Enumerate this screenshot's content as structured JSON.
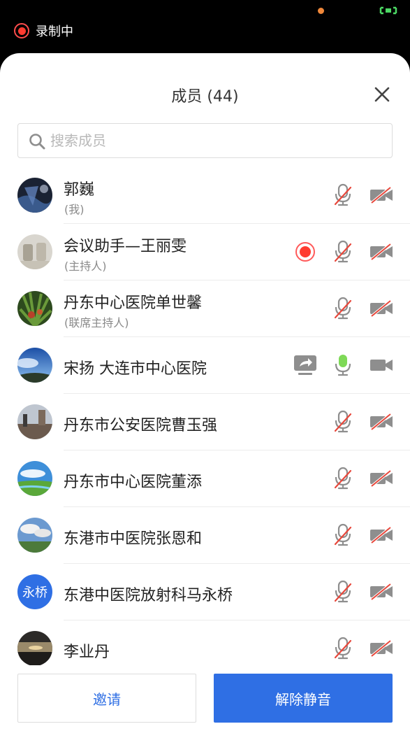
{
  "status_bar": {
    "recording_label": "录制中"
  },
  "sheet": {
    "title": "成员 (44)",
    "search_placeholder": "搜索成员"
  },
  "members": [
    {
      "name": "郭巍",
      "role": "(我)",
      "mic": "muted",
      "camera": "off",
      "recording": false,
      "screen_share": false
    },
    {
      "name": "会议助手—王丽雯",
      "role": "(主持人)",
      "mic": "muted",
      "camera": "off",
      "recording": true,
      "screen_share": false
    },
    {
      "name": "丹东中心医院单世馨",
      "role": "(联席主持人)",
      "mic": "muted",
      "camera": "off",
      "recording": false,
      "screen_share": false
    },
    {
      "name": "宋扬 大连市中心医院",
      "role": "",
      "mic": "on",
      "camera": "on",
      "recording": false,
      "screen_share": true
    },
    {
      "name": "丹东市公安医院曹玉强",
      "role": "",
      "mic": "muted",
      "camera": "off",
      "recording": false,
      "screen_share": false
    },
    {
      "name": "丹东市中心医院董添",
      "role": "",
      "mic": "muted",
      "camera": "off",
      "recording": false,
      "screen_share": false
    },
    {
      "name": "东港市中医院张恩和",
      "role": "",
      "mic": "muted",
      "camera": "off",
      "recording": false,
      "screen_share": false
    },
    {
      "name": "东港中医院放射科马永桥",
      "role": "",
      "mic": "muted",
      "camera": "off",
      "recording": false,
      "screen_share": false,
      "avatar_text": "永桥"
    },
    {
      "name": "李业丹",
      "role": "",
      "mic": "muted",
      "camera": "off",
      "recording": false,
      "screen_share": false
    }
  ],
  "footer": {
    "invite_label": "邀请",
    "unmute_all_label": "解除静音"
  },
  "colors": {
    "accent": "#2f6fe4",
    "record_red": "#ff3b30",
    "mic_active": "#7ed957",
    "icon_gray": "#8e8e8e",
    "mute_slash": "#e8473b"
  }
}
